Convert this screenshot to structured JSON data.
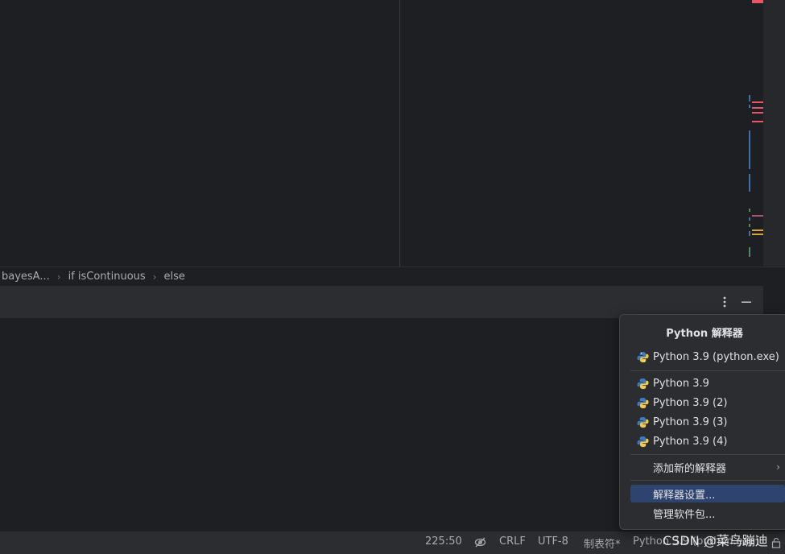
{
  "breadcrumbs": [
    "bayesA...",
    "if isContinuous",
    "else"
  ],
  "popup": {
    "title": "Python 解释器",
    "current": "Python 3.9 (python.exe)",
    "interpreters": [
      "Python 3.9",
      "Python 3.9 (2)",
      "Python 3.9 (3)",
      "Python 3.9 (4)"
    ],
    "add_new": "添加新的解释器",
    "settings": "解释器设置...",
    "manage_packages": "管理软件包..."
  },
  "status": {
    "position": "225:50",
    "line_separator": "CRLF",
    "encoding": "UTF-8",
    "indent": "制表符*",
    "interpreter": "Python 3.9 (python.exe)"
  },
  "watermark": "CSDN @菜鸟蹦迪",
  "icons": {
    "options": "more-vertical-icon",
    "minimize": "minimize-icon",
    "readonly": "eye-off-icon",
    "python": "python-icon",
    "lock": "lock-icon"
  },
  "colors": {
    "background": "#1e1f22",
    "panel": "#2b2d30",
    "selection": "#2e436e",
    "error_marker": "#e55765",
    "warning_marker": "#d7a43d",
    "change_marker": "#3d6fa8",
    "added_marker": "#4f8a5a"
  }
}
